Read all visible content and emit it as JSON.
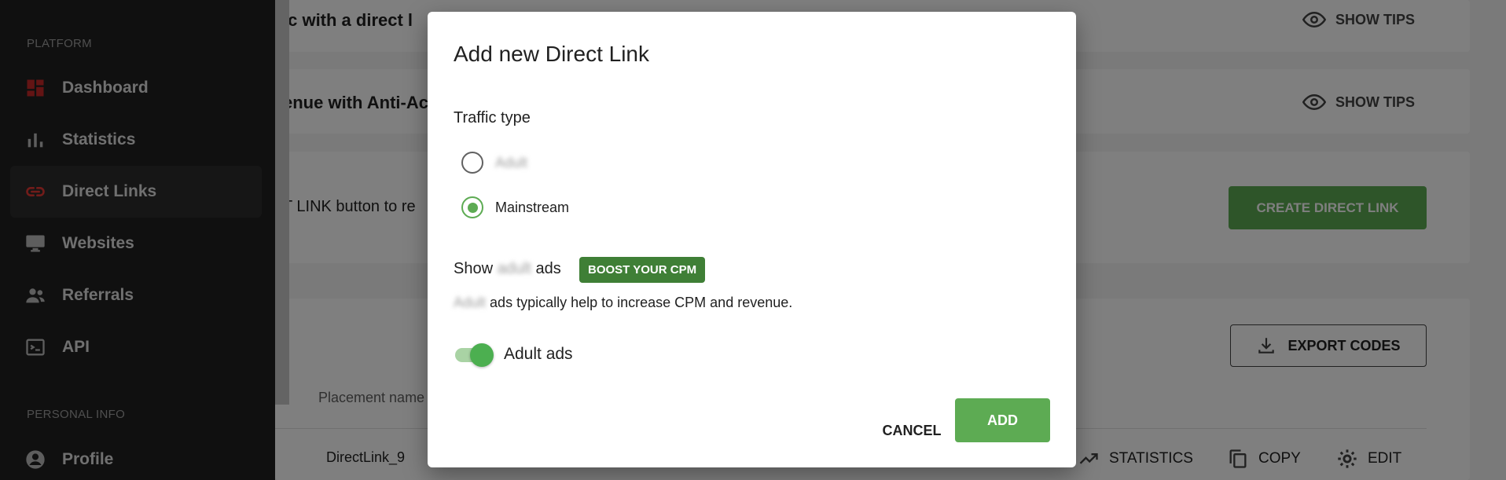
{
  "sidebar": {
    "section_platform": "PLATFORM",
    "section_personal": "PERSONAL INFO",
    "items": [
      {
        "label": "Dashboard",
        "icon": "dashboard-icon"
      },
      {
        "label": "Statistics",
        "icon": "bar-chart-icon"
      },
      {
        "label": "Direct Links",
        "icon": "link-icon",
        "active": true
      },
      {
        "label": "Websites",
        "icon": "monitor-icon"
      },
      {
        "label": "Referrals",
        "icon": "people-icon"
      },
      {
        "label": "API",
        "icon": "terminal-icon"
      }
    ],
    "profile_label": "Profile"
  },
  "background": {
    "tip1_text": "ic with a direct l",
    "tip2_text": "enue with Anti-Ac",
    "show_tips_label": "SHOW TIPS",
    "create_hint": "T LINK button to re",
    "create_button": "CREATE DIRECT LINK",
    "export_button": "EXPORT CODES",
    "table_header_placement": "Placement name",
    "row_name": "DirectLink_9",
    "row_actions": {
      "statistics": "STATISTICS",
      "copy": "COPY",
      "edit": "EDIT"
    }
  },
  "modal": {
    "title": "Add new Direct Link",
    "traffic_type_label": "Traffic type",
    "option_adult": "Adult",
    "option_mainstream": "Mainstream",
    "selected_option": "Mainstream",
    "show_label_prefix": "Show",
    "show_label_word": "adult",
    "show_label_suffix": "ads",
    "boost_badge": "BOOST YOUR CPM",
    "desc_word": "Adult",
    "desc_rest": "ads typically help to increase CPM and revenue.",
    "toggle_label": "Adult ads",
    "toggle_on": true,
    "cancel_button": "CANCEL",
    "add_button": "ADD"
  },
  "colors": {
    "accent_green": "#5dab53",
    "badge_green": "#3f7f36",
    "sidebar_bg": "#212121",
    "active_icon_red": "#e53935"
  }
}
